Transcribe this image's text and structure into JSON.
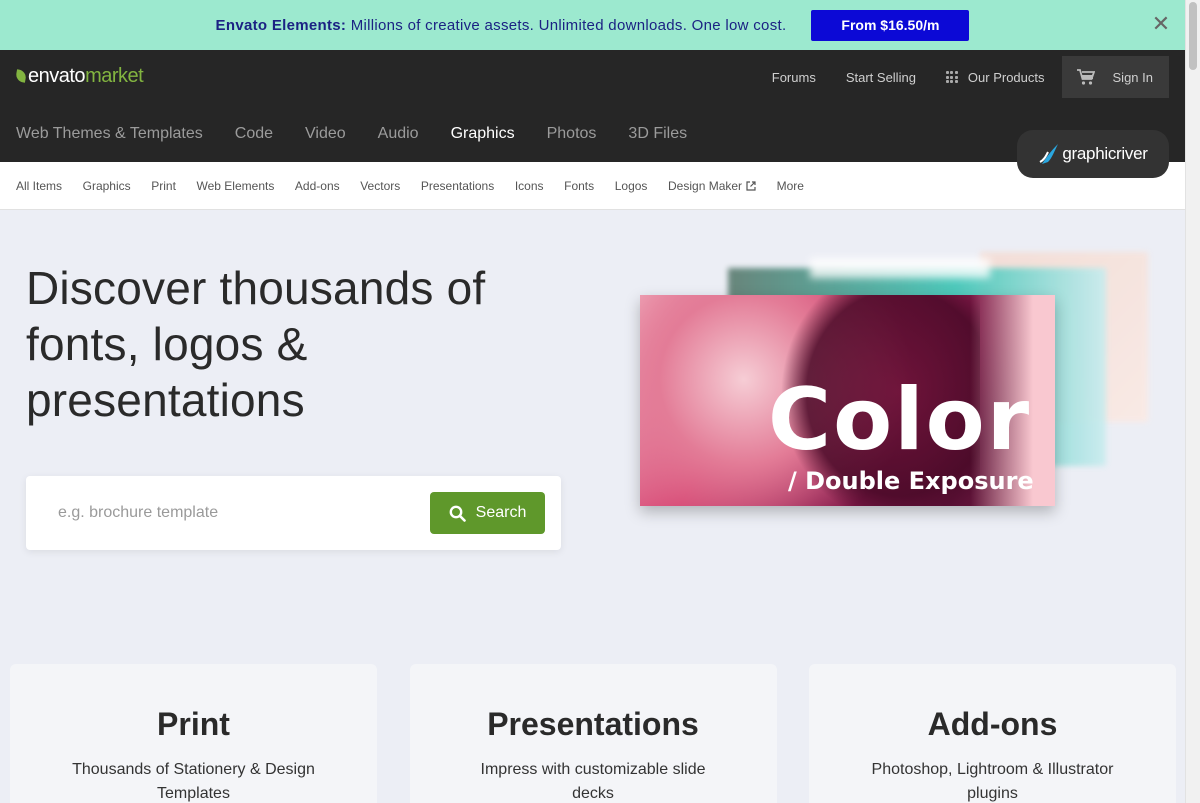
{
  "banner": {
    "brand": "Envato Elements:",
    "message": "Millions of creative assets. Unlimited downloads. One low cost.",
    "cta": "From $16.50/m",
    "close_glyph": "✕"
  },
  "header": {
    "logo": {
      "part1": "envato",
      "part2": "market"
    },
    "top_links": {
      "forums": "Forums",
      "start_selling": "Start Selling",
      "our_products": "Our Products",
      "sign_in": "Sign In"
    },
    "categories": [
      "Web Themes & Templates",
      "Code",
      "Video",
      "Audio",
      "Graphics",
      "Photos",
      "3D Files"
    ],
    "active_category": "Graphics",
    "site_badge": "graphicriver"
  },
  "subnav": {
    "items": [
      "All Items",
      "Graphics",
      "Print",
      "Web Elements",
      "Add-ons",
      "Vectors",
      "Presentations",
      "Icons",
      "Fonts",
      "Logos",
      "Design Maker",
      "More"
    ]
  },
  "hero": {
    "title": "Discover thousands of fonts, logos & presentations",
    "search_placeholder": "e.g. brochure template",
    "search_button": "Search",
    "image_title": "Color",
    "image_subtitle": "/ Double Exposure"
  },
  "cards": [
    {
      "title": "Print",
      "desc": "Thousands of Stationery & Design Templates"
    },
    {
      "title": "Presentations",
      "desc": "Impress with customizable slide decks"
    },
    {
      "title": "Add-ons",
      "desc": "Photoshop, Lightroom & Illustrator plugins"
    }
  ],
  "colors": {
    "accent_green": "#82b440",
    "search_green": "#5f982b",
    "banner_bg": "#9ce9cf",
    "banner_btn": "#0c09d6",
    "header_bg": "#262626"
  }
}
